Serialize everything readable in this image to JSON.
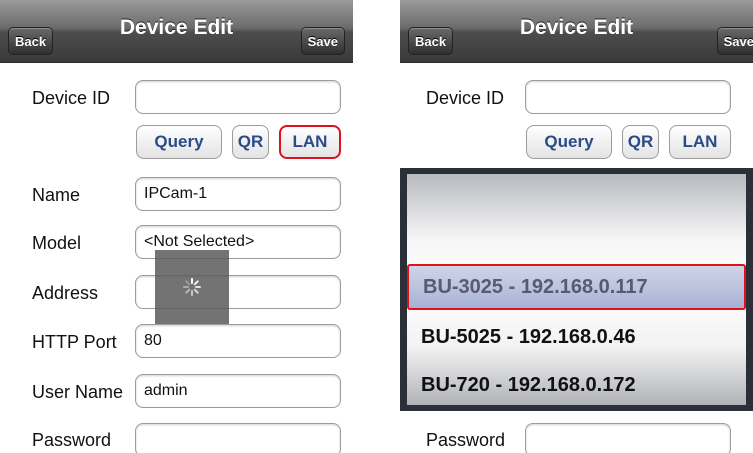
{
  "left": {
    "nav": {
      "back": "Back",
      "title": "Device Edit",
      "save": "Save"
    },
    "device_id": {
      "label": "Device ID",
      "value": ""
    },
    "buttons": {
      "query": "Query",
      "qr": "QR",
      "lan": "LAN"
    },
    "name": {
      "label": "Name",
      "value": "IPCam-1"
    },
    "model": {
      "label": "Model",
      "value": "<Not Selected>"
    },
    "address": {
      "label": "Address",
      "value": ""
    },
    "http_port": {
      "label": "HTTP Port",
      "value": "80"
    },
    "user_name": {
      "label": "User Name",
      "value": "admin"
    },
    "password": {
      "label": "Password",
      "value": ""
    }
  },
  "right": {
    "nav": {
      "back": "Back",
      "title": "Device Edit",
      "save": "Save"
    },
    "device_id": {
      "label": "Device ID",
      "value": ""
    },
    "buttons": {
      "query": "Query",
      "qr": "QR",
      "lan": "LAN"
    },
    "picker": {
      "options": [
        "BU-3025 - 192.168.0.117",
        "BU-5025 - 192.168.0.46",
        "BU-720 - 192.168.0.172"
      ],
      "selected_index": 0
    },
    "password": {
      "label": "Password",
      "value": ""
    }
  },
  "colors": {
    "highlight": "#e0111b",
    "button_text": "#2a4a88"
  }
}
